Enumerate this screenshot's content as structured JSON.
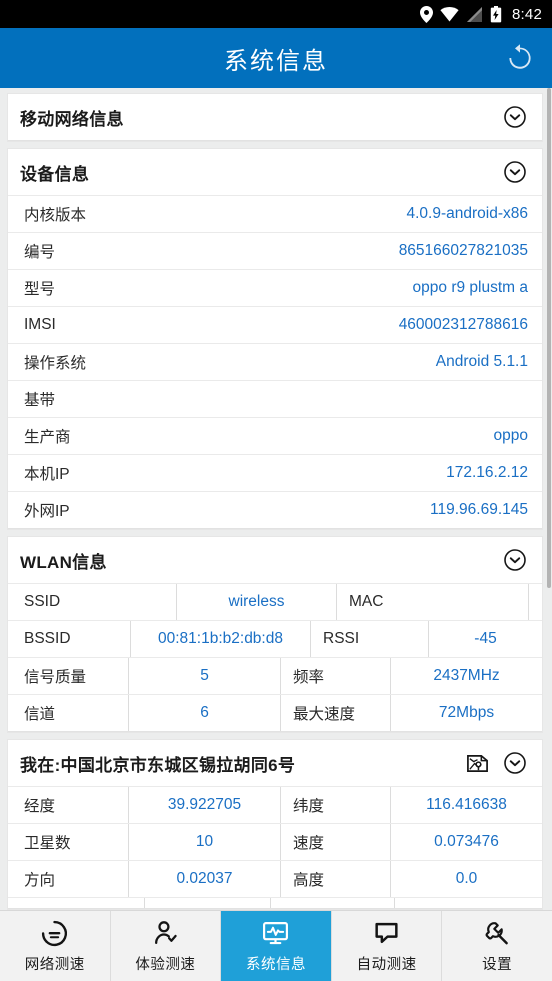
{
  "status_bar": {
    "time": "8:42",
    "icons": [
      "location-pin-icon",
      "wifi-icon",
      "cell-signal-icon",
      "battery-charging-icon"
    ]
  },
  "app_bar": {
    "title": "系统信息",
    "refresh_label": "refresh-icon"
  },
  "colors": {
    "header_blue": "#0270bd",
    "active_tab_blue": "#1fa0d8",
    "value_blue": "#1a6fc4",
    "page_bg": "#eceded"
  },
  "sections": {
    "mobile_network": {
      "title": "移动网络信息",
      "collapsed": true
    },
    "device_info": {
      "title": "设备信息",
      "rows": [
        {
          "key": "内核版本",
          "value": "4.0.9-android-x86"
        },
        {
          "key": "编号",
          "value": "865166027821035"
        },
        {
          "key": "型号",
          "value": "oppo r9 plustm a"
        },
        {
          "key": "IMSI",
          "value": "460002312788616"
        },
        {
          "key": "操作系统",
          "value": "Android 5.1.1"
        },
        {
          "key": "基带",
          "value": ""
        },
        {
          "key": "生产商",
          "value": "oppo"
        },
        {
          "key": "本机IP",
          "value": "172.16.2.12"
        },
        {
          "key": "外网IP",
          "value": "119.96.69.145"
        }
      ]
    },
    "wlan_info": {
      "title": "WLAN信息",
      "rows": [
        {
          "k1": "SSID",
          "v1": "wireless",
          "k2": "MAC",
          "v2": ""
        },
        {
          "k1": "BSSID",
          "v1": "00:81:1b:b2:db:d8",
          "k2": "RSSI",
          "v2": "-45"
        },
        {
          "k1": "信号质量",
          "v1": "5",
          "k2": "频率",
          "v2": "2437MHz"
        },
        {
          "k1": "信道",
          "v1": "6",
          "k2": "最大速度",
          "v2": "72Mbps"
        }
      ]
    },
    "location_info": {
      "title": "我在:中国北京市东城区锡拉胡同6号",
      "map_icon": "map-icon",
      "rows": [
        {
          "k1": "经度",
          "v1": "39.922705",
          "k2": "纬度",
          "v2": "116.416638"
        },
        {
          "k1": "卫星数",
          "v1": "10",
          "k2": "速度",
          "v2": "0.073476"
        },
        {
          "k1": "方向",
          "v1": "0.02037",
          "k2": "高度",
          "v2": "0.0"
        }
      ]
    }
  },
  "bottom_nav": {
    "items": [
      {
        "label": "网络测速",
        "icon": "speedometer-icon",
        "active": false
      },
      {
        "label": "体验测速",
        "icon": "person-check-icon",
        "active": false
      },
      {
        "label": "系统信息",
        "icon": "monitor-pulse-icon",
        "active": true
      },
      {
        "label": "自动测速",
        "icon": "speech-bubble-icon",
        "active": false
      },
      {
        "label": "设置",
        "icon": "wrench-icon",
        "active": false
      }
    ]
  }
}
